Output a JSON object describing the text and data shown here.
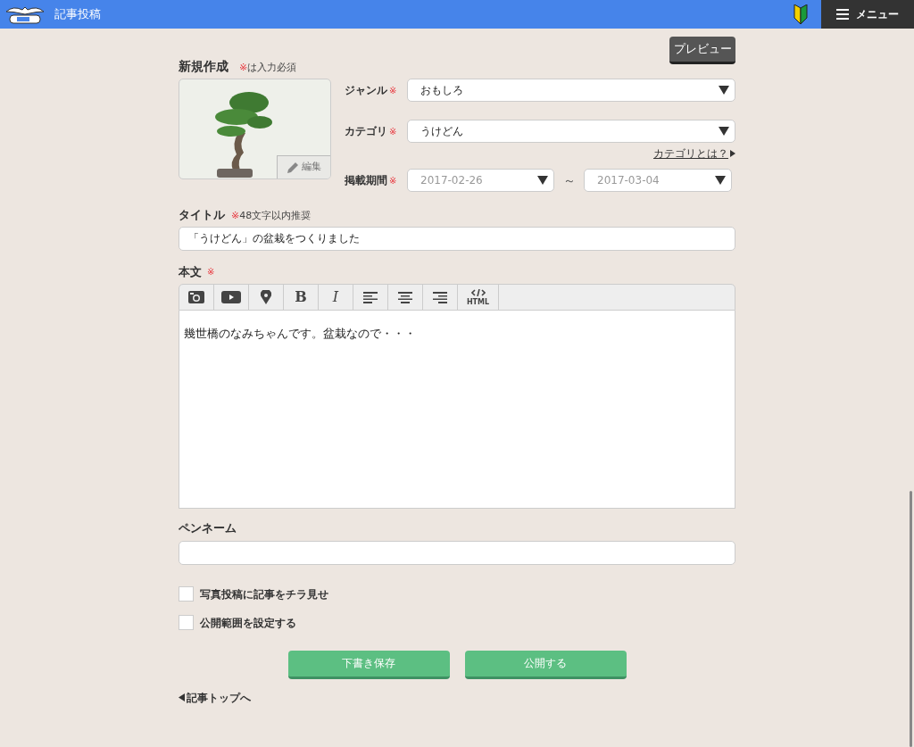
{
  "header": {
    "title": "記事投稿",
    "menu_label": "メニュー"
  },
  "preview_button": "プレビュー",
  "section_title": "新規作成",
  "required_note_mark": "※",
  "required_note": "は入力必須",
  "image": {
    "edit_label": "編集"
  },
  "selects": [
    {
      "label": "ジャンル",
      "mark": "※",
      "value": "おもしろ"
    },
    {
      "label": "カテゴリ",
      "mark": "※",
      "value": "うけどん"
    }
  ],
  "category_help_link": "カテゴリとは？",
  "period": {
    "label": "掲載期間",
    "mark": "※",
    "start": "2017-02-26",
    "separator": "～",
    "end": "2017-03-04"
  },
  "title_field": {
    "label": "タイトル",
    "mark": "※",
    "note": "48文字以内推奨",
    "value": "「うけどん」の盆栽をつくりました"
  },
  "body": {
    "label": "本文",
    "mark": "※",
    "value": "幾世橋のなみちゃんです。盆栽なので・・・"
  },
  "toolbar": [
    {
      "kind": "camera"
    },
    {
      "kind": "video"
    },
    {
      "kind": "pin"
    },
    {
      "kind": "bold",
      "text": "B"
    },
    {
      "kind": "italic",
      "text": "I"
    },
    {
      "kind": "align-left"
    },
    {
      "kind": "align-center"
    },
    {
      "kind": "align-right"
    },
    {
      "kind": "html",
      "text": "HTML"
    }
  ],
  "pen_name": {
    "label": "ペンネーム"
  },
  "checkboxes": [
    {
      "label": "写真投稿に記事をチラ見せ",
      "checked": false
    },
    {
      "label": "公開範囲を設定する",
      "checked": false
    }
  ],
  "buttons": [
    "下書き保存",
    "公開する"
  ],
  "back_link": "記事トップへ"
}
